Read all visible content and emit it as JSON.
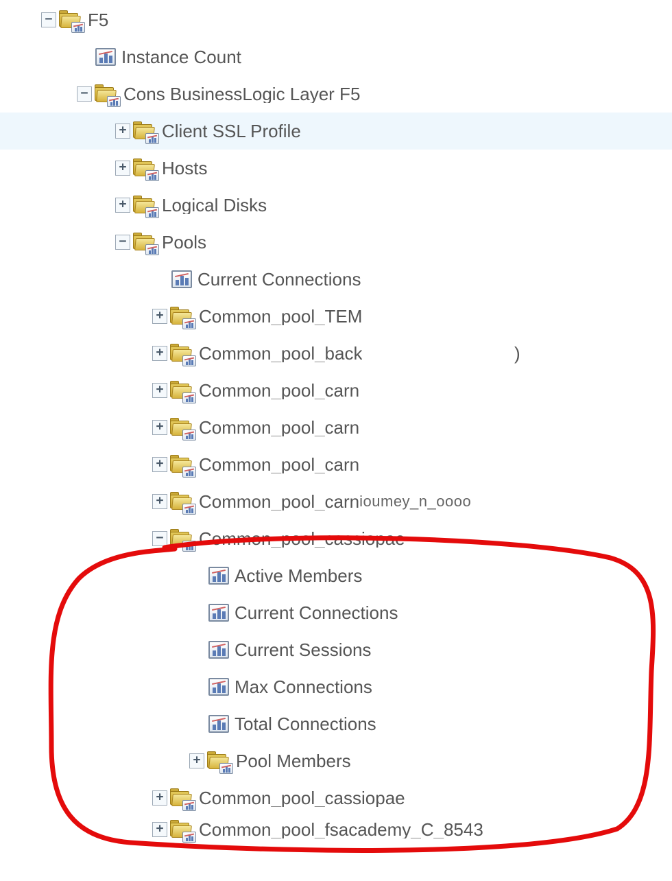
{
  "tree": {
    "f5": "F5",
    "instance_count": "Instance Count",
    "cons_bl_layer": "Cons BusinessLogic Layer F5",
    "client_ssl": "Client SSL Profile",
    "hosts": "Hosts",
    "logical_disks": "Logical Disks",
    "pools": "Pools",
    "pools_curr_conn": "Current Connections",
    "pool_tem": "Common_pool_TEM",
    "pool_back": "Common_pool_back",
    "pool_back_trail": ")",
    "pool_carn1": "Common_pool_carn",
    "pool_carn2": "Common_pool_carn",
    "pool_carn3": "Common_pool_carn",
    "pool_carn4": "Common_pool_carn",
    "pool_carn4_trail": "ioumey_n_oooo",
    "pool_cassiopae": "Common_pool_cassiopae",
    "active_members": "Active Members",
    "curr_conn": "Current Connections",
    "curr_sess": "Current Sessions",
    "max_conn": "Max Connections",
    "total_conn": "Total Connections",
    "pool_members": "Pool Members",
    "pool_cassiopae2": "Common_pool_cassiopae",
    "pool_fsacademy": "Common_pool_fsacademy_C_8543"
  }
}
